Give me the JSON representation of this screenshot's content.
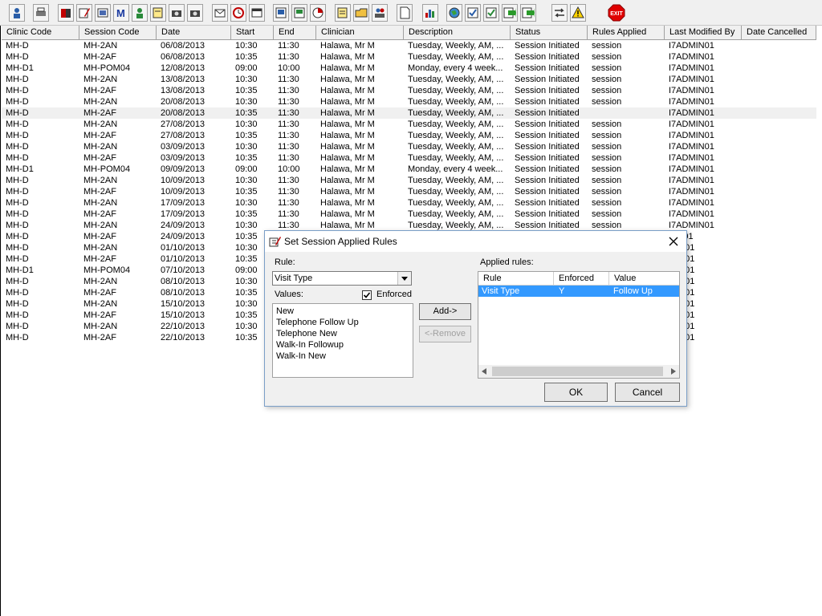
{
  "toolbar": {
    "icons": [
      "user-search-icon",
      "print-icon",
      "book-icon",
      "pencil-doc-icon",
      "image-icon",
      "m-icon",
      "person-icon",
      "note-icon",
      "camera-icon",
      "camera2-icon",
      "mail-icon",
      "clock-icon",
      "window-icon",
      "grid-icon",
      "doc-icon",
      "chart-icon",
      "notepad-icon",
      "folder-icon",
      "people-icon",
      "page-icon",
      "bar-chart-icon",
      "globe-icon",
      "checklist-icon",
      "checklist2-icon",
      "green-arrow-icon",
      "green-arrow2-icon",
      "swap-icon",
      "warning-icon",
      "exit-icon"
    ],
    "exit_label": "EXIT"
  },
  "grid": {
    "columns": [
      "Clinic Code",
      "Session Code",
      "Date",
      "Start",
      "End",
      "Clinician",
      "Description",
      "Status",
      "Rules Applied",
      "Last Modified By",
      "Date Cancelled"
    ],
    "rows": [
      [
        "MH-D",
        "MH-2AN",
        "06/08/2013",
        "10:30",
        "11:30",
        "Halawa, Mr M",
        "Tuesday, Weekly, AM, ...",
        "Session Initiated",
        "session",
        "I7ADMIN01",
        ""
      ],
      [
        "MH-D",
        "MH-2AF",
        "06/08/2013",
        "10:35",
        "11:30",
        "Halawa, Mr M",
        "Tuesday, Weekly, AM, ...",
        "Session Initiated",
        "session",
        "I7ADMIN01",
        ""
      ],
      [
        "MH-D1",
        "MH-POM04",
        "12/08/2013",
        "09:00",
        "10:00",
        "Halawa, Mr M",
        "Monday, every 4 week...",
        "Session Initiated",
        "session",
        "I7ADMIN01",
        ""
      ],
      [
        "MH-D",
        "MH-2AN",
        "13/08/2013",
        "10:30",
        "11:30",
        "Halawa, Mr M",
        "Tuesday, Weekly, AM, ...",
        "Session Initiated",
        "session",
        "I7ADMIN01",
        ""
      ],
      [
        "MH-D",
        "MH-2AF",
        "13/08/2013",
        "10:35",
        "11:30",
        "Halawa, Mr M",
        "Tuesday, Weekly, AM, ...",
        "Session Initiated",
        "session",
        "I7ADMIN01",
        ""
      ],
      [
        "MH-D",
        "MH-2AN",
        "20/08/2013",
        "10:30",
        "11:30",
        "Halawa, Mr M",
        "Tuesday, Weekly, AM, ...",
        "Session Initiated",
        "session",
        "I7ADMIN01",
        ""
      ],
      [
        "MH-D",
        "MH-2AF",
        "20/08/2013",
        "10:35",
        "11:30",
        "Halawa, Mr M",
        "Tuesday, Weekly, AM, ...",
        "Session Initiated",
        "",
        "I7ADMIN01",
        ""
      ],
      [
        "MH-D",
        "MH-2AN",
        "27/08/2013",
        "10:30",
        "11:30",
        "Halawa, Mr M",
        "Tuesday, Weekly, AM, ...",
        "Session Initiated",
        "session",
        "I7ADMIN01",
        ""
      ],
      [
        "MH-D",
        "MH-2AF",
        "27/08/2013",
        "10:35",
        "11:30",
        "Halawa, Mr M",
        "Tuesday, Weekly, AM, ...",
        "Session Initiated",
        "session",
        "I7ADMIN01",
        ""
      ],
      [
        "MH-D",
        "MH-2AN",
        "03/09/2013",
        "10:30",
        "11:30",
        "Halawa, Mr M",
        "Tuesday, Weekly, AM, ...",
        "Session Initiated",
        "session",
        "I7ADMIN01",
        ""
      ],
      [
        "MH-D",
        "MH-2AF",
        "03/09/2013",
        "10:35",
        "11:30",
        "Halawa, Mr M",
        "Tuesday, Weekly, AM, ...",
        "Session Initiated",
        "session",
        "I7ADMIN01",
        ""
      ],
      [
        "MH-D1",
        "MH-POM04",
        "09/09/2013",
        "09:00",
        "10:00",
        "Halawa, Mr M",
        "Monday, every 4 week...",
        "Session Initiated",
        "session",
        "I7ADMIN01",
        ""
      ],
      [
        "MH-D",
        "MH-2AN",
        "10/09/2013",
        "10:30",
        "11:30",
        "Halawa, Mr M",
        "Tuesday, Weekly, AM, ...",
        "Session Initiated",
        "session",
        "I7ADMIN01",
        ""
      ],
      [
        "MH-D",
        "MH-2AF",
        "10/09/2013",
        "10:35",
        "11:30",
        "Halawa, Mr M",
        "Tuesday, Weekly, AM, ...",
        "Session Initiated",
        "session",
        "I7ADMIN01",
        ""
      ],
      [
        "MH-D",
        "MH-2AN",
        "17/09/2013",
        "10:30",
        "11:30",
        "Halawa, Mr M",
        "Tuesday, Weekly, AM, ...",
        "Session Initiated",
        "session",
        "I7ADMIN01",
        ""
      ],
      [
        "MH-D",
        "MH-2AF",
        "17/09/2013",
        "10:35",
        "11:30",
        "Halawa, Mr M",
        "Tuesday, Weekly, AM, ...",
        "Session Initiated",
        "session",
        "I7ADMIN01",
        ""
      ],
      [
        "MH-D",
        "MH-2AN",
        "24/09/2013",
        "10:30",
        "11:30",
        "Halawa, Mr M",
        "Tuesday, Weekly, AM, ...",
        "Session Initiated",
        "session",
        "I7ADMIN01",
        ""
      ],
      [
        "MH-D",
        "MH-2AF",
        "24/09/2013",
        "10:35",
        "",
        "",
        "",
        "",
        "",
        "AIN01",
        ""
      ],
      [
        "MH-D",
        "MH-2AN",
        "01/10/2013",
        "10:30",
        "",
        "",
        "",
        "",
        "",
        "MIN01",
        ""
      ],
      [
        "MH-D",
        "MH-2AF",
        "01/10/2013",
        "10:35",
        "",
        "",
        "",
        "",
        "",
        "MIN01",
        ""
      ],
      [
        "MH-D1",
        "MH-POM04",
        "07/10/2013",
        "09:00",
        "",
        "",
        "",
        "",
        "",
        "MIN01",
        ""
      ],
      [
        "MH-D",
        "MH-2AN",
        "08/10/2013",
        "10:30",
        "",
        "",
        "",
        "",
        "",
        "MIN01",
        ""
      ],
      [
        "MH-D",
        "MH-2AF",
        "08/10/2013",
        "10:35",
        "",
        "",
        "",
        "",
        "",
        "MIN01",
        ""
      ],
      [
        "MH-D",
        "MH-2AN",
        "15/10/2013",
        "10:30",
        "",
        "",
        "",
        "",
        "",
        "MIN01",
        ""
      ],
      [
        "MH-D",
        "MH-2AF",
        "15/10/2013",
        "10:35",
        "",
        "",
        "",
        "",
        "",
        "MIN01",
        ""
      ],
      [
        "MH-D",
        "MH-2AN",
        "22/10/2013",
        "10:30",
        "",
        "",
        "",
        "",
        "",
        "MIN01",
        ""
      ],
      [
        "MH-D",
        "MH-2AF",
        "22/10/2013",
        "10:35",
        "",
        "",
        "",
        "",
        "",
        "MIN01",
        ""
      ]
    ],
    "selected_row": 6
  },
  "dialog": {
    "title": "Set Session Applied Rules",
    "rule_label": "Rule:",
    "rule_value": "Visit Type",
    "values_label": "Values:",
    "enforced_label": "Enforced",
    "enforced_checked": true,
    "values": [
      "New",
      "Telephone Follow Up",
      "Telephone New",
      "Walk-In Followup",
      "Walk-In New"
    ],
    "add_label": "Add->",
    "remove_label": "<-Remove",
    "applied_label": "Applied rules:",
    "applied_columns": [
      "Rule",
      "Enforced",
      "Value"
    ],
    "applied_rows": [
      [
        "Visit Type",
        "Y",
        "Follow Up"
      ]
    ],
    "ok_label": "OK",
    "cancel_label": "Cancel"
  },
  "colors": {
    "selection": "#3399ff",
    "window_bg": "#f0f0f0",
    "exit_red": "#e00000"
  }
}
